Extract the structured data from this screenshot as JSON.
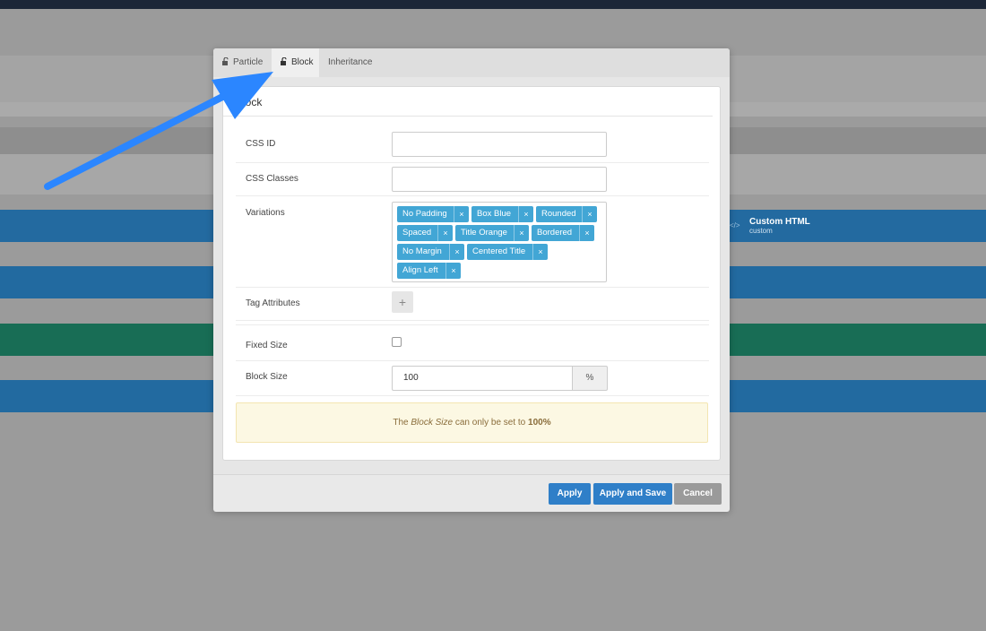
{
  "background": {
    "side_item_title": "Custom HTML",
    "side_item_subtitle": "custom",
    "side_item_icon": "code-icon",
    "band_colors": [
      "#236aa0",
      "#226aa0",
      "#186d55",
      "#226aa0"
    ]
  },
  "modal": {
    "tabs": [
      {
        "label": "Particle",
        "icon": "lock-open-icon"
      },
      {
        "label": "Block",
        "icon": "lock-open-icon",
        "active": true
      },
      {
        "label": "Inheritance"
      }
    ],
    "panel_title": "Block",
    "fields": {
      "css_id_label": "CSS ID",
      "css_id_value": "",
      "css_classes_label": "CSS Classes",
      "css_classes_value": "",
      "variations_label": "Variations",
      "variations": [
        "No Padding",
        "Box Blue",
        "Rounded",
        "Spaced",
        "Title Orange",
        "Bordered",
        "No Margin",
        "Centered Title",
        "Align Left"
      ],
      "tag_attributes_label": "Tag Attributes",
      "tag_attributes_add": "+",
      "fixed_size_label": "Fixed Size",
      "fixed_size_checked": false,
      "block_size_label": "Block Size",
      "block_size_value": "100",
      "block_size_unit": "%",
      "remove_glyph": "×"
    },
    "notice": {
      "prefix": "The ",
      "emphasis": "Block Size",
      "middle": " can only be set to ",
      "strong": "100%"
    },
    "buttons": {
      "apply": "Apply",
      "apply_save": "Apply and Save",
      "cancel": "Cancel"
    }
  },
  "colors": {
    "accent_blue": "#2f7fc8",
    "chip_blue": "#42a6d5",
    "annotation_arrow": "#2b86ff",
    "notice_bg": "#fcf8e3"
  }
}
